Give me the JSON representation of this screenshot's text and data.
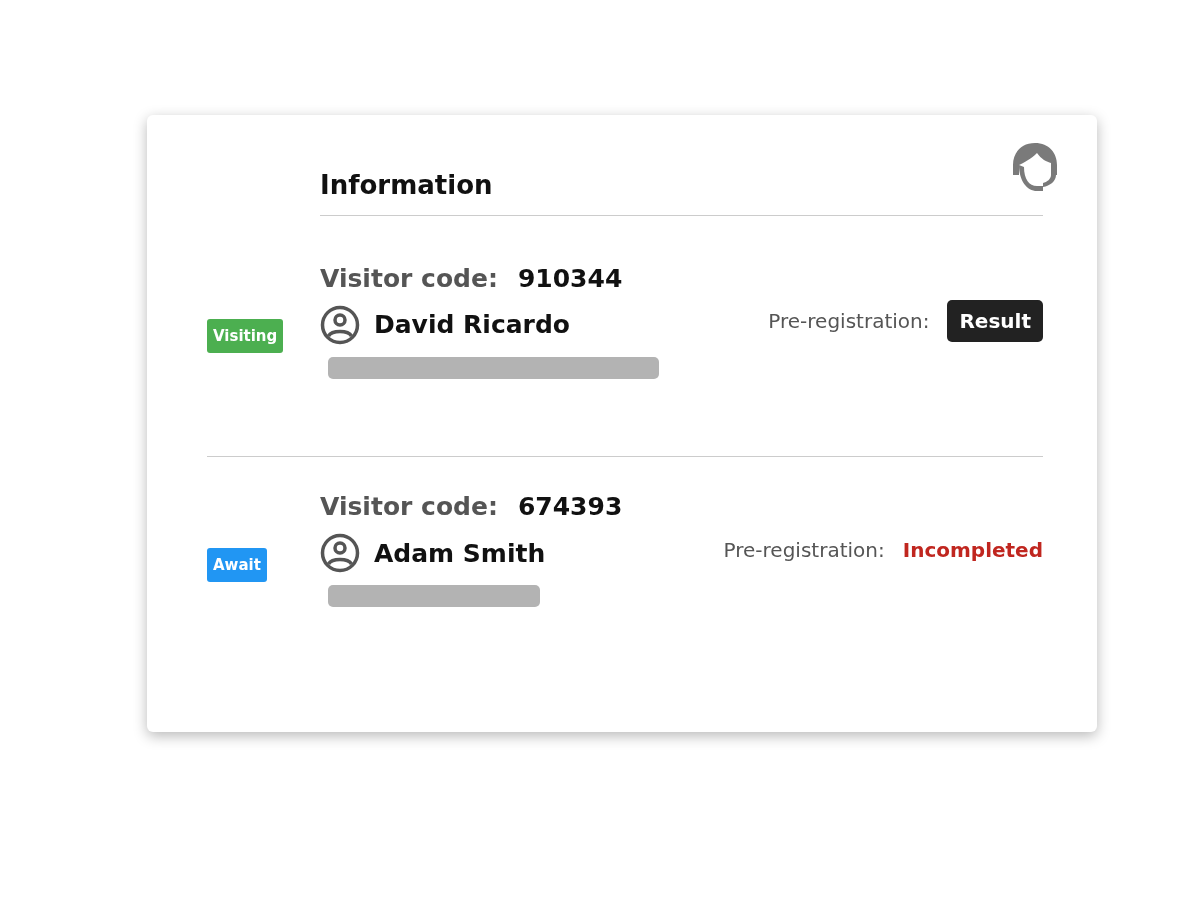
{
  "title": "Information",
  "visitors": [
    {
      "status": {
        "label": "Visiting",
        "color": "#4caf50"
      },
      "code_label": "Visitor code:",
      "code": "910344",
      "name": "David Ricardo",
      "prereg_label": "Pre-registration:",
      "prereg": {
        "kind": "button",
        "text": "Result"
      }
    },
    {
      "status": {
        "label": "Await",
        "color": "#2196f3"
      },
      "code_label": "Visitor code:",
      "code": "674393",
      "name": "Adam Smith",
      "prereg_label": "Pre-registration:",
      "prereg": {
        "kind": "status",
        "text": "Incompleted"
      }
    }
  ]
}
